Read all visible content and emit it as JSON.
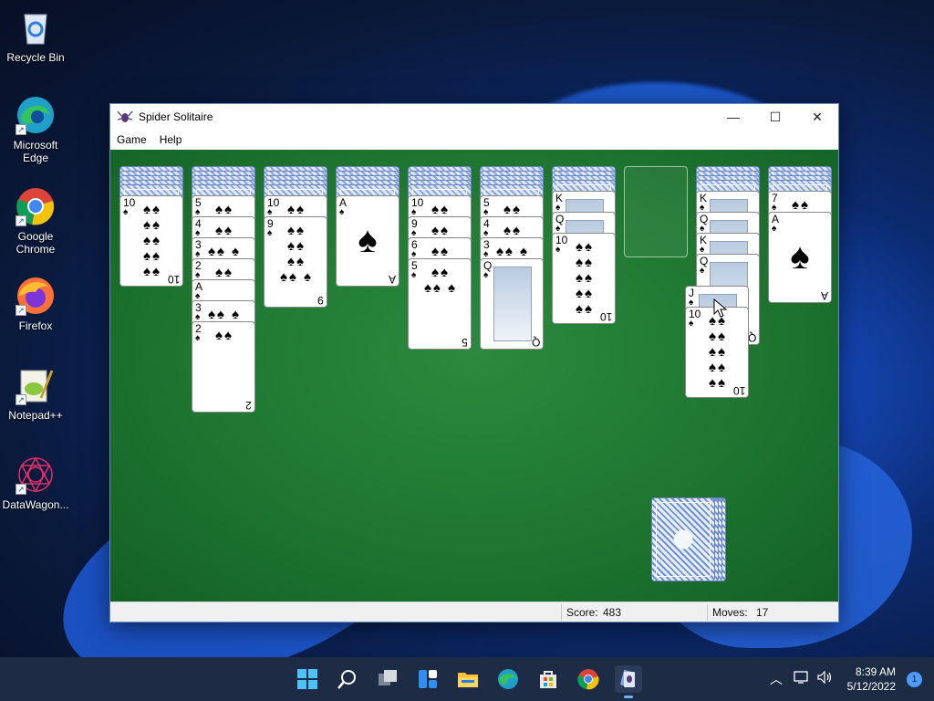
{
  "desktop": {
    "icons": [
      {
        "label": "Recycle Bin"
      },
      {
        "label": "Microsoft Edge"
      },
      {
        "label": "Google Chrome"
      },
      {
        "label": "Firefox"
      },
      {
        "label": "Notepad++"
      },
      {
        "label": "DataWagon..."
      }
    ]
  },
  "window": {
    "title": "Spider Solitaire",
    "menu": [
      "Game",
      "Help"
    ],
    "controls": {
      "minimize": "—",
      "maximize": "☐",
      "close": "✕"
    },
    "status": {
      "score_label": "Score:",
      "score_value": "483",
      "moves_label": "Moves:",
      "moves_value": "17"
    }
  },
  "game": {
    "suit": "♠",
    "columns": [
      {
        "face_up": [
          {
            "rank": "10"
          }
        ]
      },
      {
        "face_up": [
          {
            "rank": "5"
          },
          {
            "rank": "4"
          },
          {
            "rank": "3"
          },
          {
            "rank": "2"
          },
          {
            "rank": "A"
          },
          {
            "rank": "3"
          },
          {
            "rank": "2"
          }
        ]
      },
      {
        "face_up": [
          {
            "rank": "10"
          },
          {
            "rank": "9"
          }
        ]
      },
      {
        "face_up": [
          {
            "rank": "A"
          }
        ]
      },
      {
        "face_up": [
          {
            "rank": "10"
          },
          {
            "rank": "9"
          },
          {
            "rank": "6"
          },
          {
            "rank": "5"
          }
        ]
      },
      {
        "face_up": [
          {
            "rank": "5"
          },
          {
            "rank": "4"
          },
          {
            "rank": "3"
          },
          {
            "rank": "Q"
          }
        ]
      },
      {
        "face_up": [
          {
            "rank": "K"
          },
          {
            "rank": "Q"
          },
          {
            "rank": "10"
          }
        ]
      },
      {
        "face_up": []
      },
      {
        "face_up": [
          {
            "rank": "K"
          },
          {
            "rank": "Q"
          },
          {
            "rank": "K"
          },
          {
            "rank": "Q"
          }
        ]
      },
      {
        "face_up": [
          {
            "rank": "7"
          },
          {
            "rank": "A"
          }
        ]
      }
    ],
    "dragging": [
      {
        "rank": "J"
      },
      {
        "rank": "10"
      }
    ],
    "stock_piles": 4
  },
  "taskbar": {
    "time": "8:39 AM",
    "date": "5/12/2022",
    "notification_count": "1",
    "icons": [
      "windows-start-icon",
      "search-icon",
      "task-view-icon",
      "widgets-icon",
      "file-explorer-icon",
      "edge-icon",
      "store-icon",
      "chrome-icon",
      "spider-solitaire-icon"
    ]
  }
}
